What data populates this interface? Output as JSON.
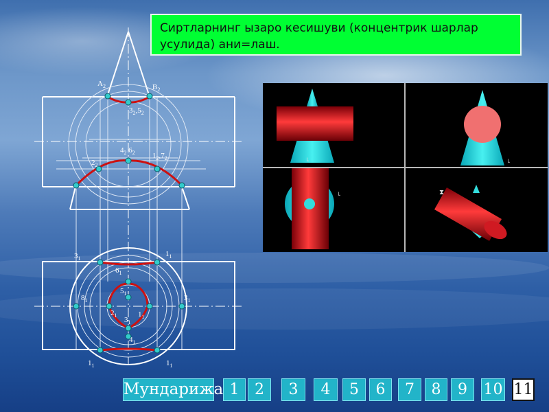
{
  "title": "Сиртларнинг ызаро кесишуви (концентрик шарлар усулида) ани=лаш.",
  "colors": {
    "title_bg": "#00ff33",
    "nav_bg": "#22b4c9",
    "curve": "#cc1111",
    "point": "#33cccc",
    "line": "#ffffff",
    "render_bg": "#000000",
    "cylinder": "#e0202a",
    "cone": "#22dddd"
  },
  "front_view_labels": {
    "a2": "A",
    "a2_sub": "2",
    "b2": "B",
    "b2_sub": "2",
    "p35": "3",
    "p35_sub": "2",
    "p35b": ",5",
    "p35b_sub": "2",
    "p46": "4",
    "p46_sub": "2",
    "p46b": " 6",
    "p46b_sub": "2",
    "p17": "1",
    "p17_sub": "2",
    "p17b": ",7",
    "p17b_sub": "2",
    "p2": "2",
    "p2_sub": "2"
  },
  "top_view_labels": {
    "t3": "3",
    "t3_sub": "1",
    "t1": "1",
    "t1_sub": "1",
    "t6": "6",
    "t6_sub": "1",
    "t5": "5",
    "t5_sub": "1",
    "t8": "8",
    "t8_sub": "1",
    "t3r": "3",
    "t3r_sub": "1",
    "t2": "2",
    "t2_sub": "1",
    "t1c": "1",
    "t1c_sub": "1",
    "t3c": "3",
    "t3c_sub": "1",
    "t4": "4",
    "t4_sub": "1",
    "t1bl": "1",
    "t1bl_sub": "1",
    "t1br": "1",
    "t1br_sub": "1"
  },
  "nav": {
    "contents": "Мундарижа",
    "pages": [
      "1",
      "2",
      "3",
      "4",
      "5",
      "6",
      "7",
      "8",
      "9",
      "10",
      "11"
    ],
    "current": "11"
  }
}
